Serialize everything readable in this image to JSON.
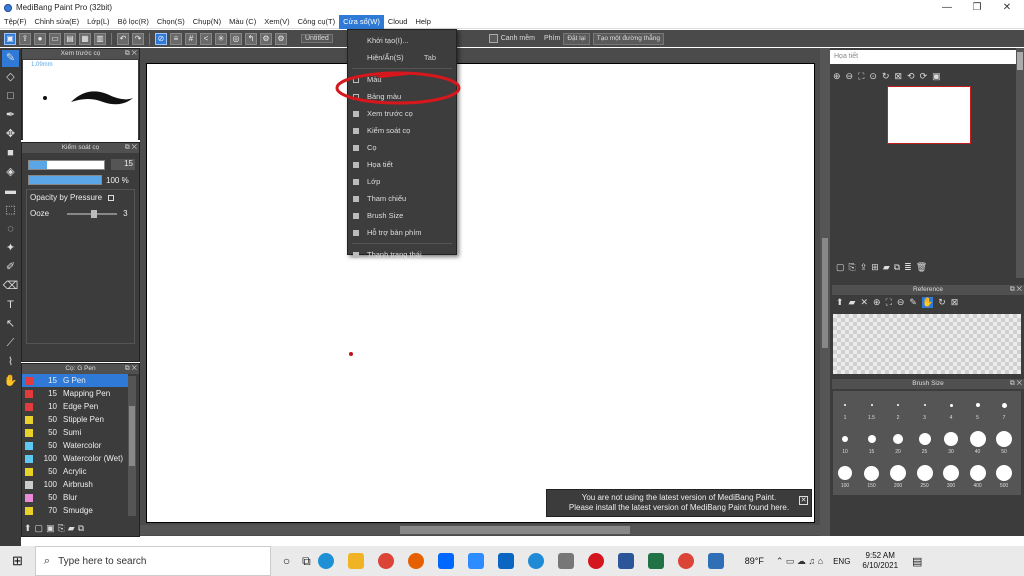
{
  "window": {
    "title": "MediBang Paint Pro (32bit)",
    "minimize": "—",
    "maximize": "❐",
    "close": "✕"
  },
  "menubar": {
    "items": [
      "Tệp(F)",
      "Chỉnh sửa(E)",
      "Lớp(L)",
      "Bộ lọc(R)",
      "Chọn(S)",
      "Chụp(N)",
      "Màu (C)",
      "Xem(V)",
      "Công cụ(T)",
      "Cửa sổ(W)",
      "Cloud",
      "Help"
    ],
    "active_index": 9
  },
  "toolbar": {
    "canvas_tab": "Untitled",
    "snap_label": "Canh mềm",
    "pen_label": "Phím",
    "reset_label": "Đặt lại",
    "create_line_label": "Tạo một đường thẳng"
  },
  "left_panels": {
    "brush_preview": {
      "title": "Xem trước cọ",
      "size_label": "1.09mm"
    },
    "brush_control": {
      "title": "Kiểm soát cọ",
      "size_value": "15",
      "opacity_value": "100 %",
      "size_fraction": 0.15,
      "opacity_fraction": 1.0,
      "pressure_label": "Opacity by Pressure",
      "ooze_label": "Ooze",
      "ooze_value": "3"
    },
    "brush_list": {
      "title": "Cọ: G Pen",
      "items": [
        {
          "size": "15",
          "name": "G Pen",
          "color": "#e23b3b",
          "selected": true
        },
        {
          "size": "15",
          "name": "Mapping Pen",
          "color": "#e23b3b"
        },
        {
          "size": "10",
          "name": "Edge Pen",
          "color": "#e23b3b"
        },
        {
          "size": "50",
          "name": "Stipple Pen",
          "color": "#e8d12a"
        },
        {
          "size": "50",
          "name": "Sumi",
          "color": "#e8d12a"
        },
        {
          "size": "50",
          "name": "Watercolor",
          "color": "#5ec8f0"
        },
        {
          "size": "100",
          "name": "Watercolor (Wet)",
          "color": "#5ec8f0"
        },
        {
          "size": "50",
          "name": "Acrylic",
          "color": "#e8d12a"
        },
        {
          "size": "100",
          "name": "Airbrush",
          "color": "#cccccc"
        },
        {
          "size": "50",
          "name": "Blur",
          "color": "#e98bd6"
        },
        {
          "size": "70",
          "name": "Smudge",
          "color": "#e8d12a"
        }
      ]
    }
  },
  "dropdown": {
    "items": [
      {
        "label": "Khởi tạo(I)...",
        "check": "none"
      },
      {
        "label": "Hiện/Ẩn(S)",
        "shortcut": "Tab",
        "check": "none"
      },
      {
        "label": "Màu",
        "check": "none"
      },
      {
        "label": "Bảng màu",
        "check": "off"
      },
      {
        "label": "Xem trước cọ",
        "check": "on"
      },
      {
        "label": "Kiểm soát cọ",
        "check": "on"
      },
      {
        "label": "Cọ",
        "check": "on"
      },
      {
        "label": "Họa tiết",
        "check": "on"
      },
      {
        "label": "Lớp",
        "check": "on"
      },
      {
        "label": "Tham chiếu",
        "check": "on"
      },
      {
        "label": "Brush Size",
        "check": "on"
      },
      {
        "label": "Hỗ trợ bàn phím",
        "check": "on"
      },
      {
        "label": "Thanh trạng thái",
        "check": "on"
      }
    ]
  },
  "right_panels": {
    "navigator": {
      "title": "Họa tiết"
    },
    "reference": {
      "title": "Reference"
    },
    "brush_size": {
      "title": "Brush Size",
      "row1": [
        "1",
        "1.5",
        "2",
        "3",
        "4",
        "5",
        "7"
      ],
      "row2": [
        "10",
        "15",
        "20",
        "25",
        "30",
        "40",
        "50"
      ],
      "row3": [
        "100",
        "150",
        "200",
        "250",
        "300",
        "400",
        "500"
      ]
    }
  },
  "notification": {
    "line1": "You are not using the latest version of MediBang Paint.",
    "line2": "Please install the latest version of MediBang Paint found here."
  },
  "taskbar": {
    "search_placeholder": "Type here to search",
    "temperature": "89°F",
    "language": "ENG",
    "time": "9:52 AM",
    "date": "6/10/2021"
  },
  "colors": {
    "accent": "#2f7ad6",
    "annotation": "#d6171c"
  }
}
